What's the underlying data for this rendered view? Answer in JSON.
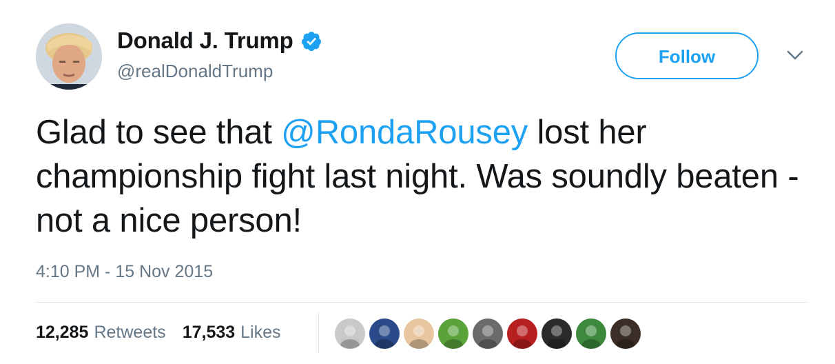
{
  "tweet": {
    "author": {
      "display_name": "Donald J. Trump",
      "handle": "@realDonaldTrump",
      "verified": true,
      "avatar_icon": "profile-photo"
    },
    "follow_label": "Follow",
    "menu_icon": "chevron-down-icon",
    "text": {
      "before_mention": "Glad to see that ",
      "mention": "@RondaRousey",
      "after_mention": " lost her championship fight last night. Was soundly beaten - not a nice person!"
    },
    "timestamp": "4:10 PM - 15 Nov 2015",
    "stats": {
      "retweets_count": "12,285",
      "retweets_label": "Retweets",
      "likes_count": "17,533",
      "likes_label": "Likes"
    },
    "liker_avatars": [
      {
        "icon": "liker-avatar-1",
        "color": "#c9c9c9"
      },
      {
        "icon": "liker-avatar-2",
        "color": "#2a4a8a"
      },
      {
        "icon": "liker-avatar-3",
        "color": "#e8c7a0"
      },
      {
        "icon": "liker-avatar-4",
        "color": "#5aa33a"
      },
      {
        "icon": "liker-avatar-5",
        "color": "#6b6b6b"
      },
      {
        "icon": "liker-avatar-6",
        "color": "#b81f1f"
      },
      {
        "icon": "liker-avatar-7",
        "color": "#2a2a2a"
      },
      {
        "icon": "liker-avatar-8",
        "color": "#3d8a3d"
      },
      {
        "icon": "liker-avatar-9",
        "color": "#3a2e26"
      }
    ]
  },
  "colors": {
    "accent": "#1da1f2",
    "text_primary": "#14171a",
    "text_secondary": "#657786",
    "divider": "#e1e8ed"
  }
}
